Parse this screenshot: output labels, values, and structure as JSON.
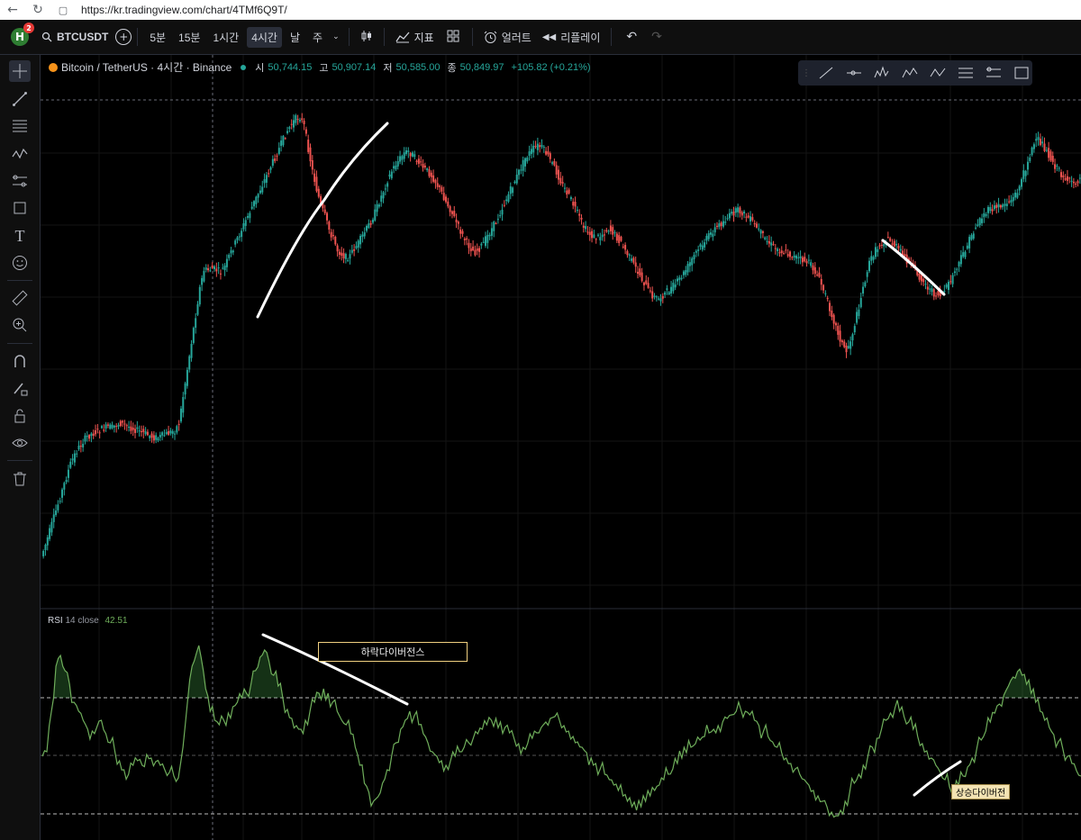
{
  "browser": {
    "url": "https://kr.tradingview.com/chart/4TMf6Q9T/"
  },
  "toolbar": {
    "avatar_letter": "H",
    "avatar_badge": "2",
    "symbol": "BTCUSDT",
    "intervals": [
      "5분",
      "15분",
      "1시간",
      "4시간",
      "날",
      "주"
    ],
    "active_interval": "4시간",
    "indicators_label": "지표",
    "alert_label": "얼러트",
    "replay_label": "리플레이"
  },
  "legend": {
    "symbol": "Bitcoin / TetherUS · 4시간 · Binance",
    "open_label": "시",
    "open": "50,744.15",
    "high_label": "고",
    "high": "50,907.14",
    "low_label": "저",
    "low": "50,585.00",
    "close_label": "종",
    "close": "50,849.97",
    "change": "+105.82 (+0.21%)"
  },
  "rsi": {
    "name": "RSI",
    "params": "14 close",
    "value": "42.51"
  },
  "annotations": {
    "bearish": "하락다이버전스",
    "bullish": "상승다이버전"
  },
  "colors": {
    "up": "#26a69a",
    "down": "#ef5350",
    "rsi_line": "#6fae5b",
    "background": "#000000"
  },
  "chart_data": {
    "type": "candlestick",
    "price_path": [
      618,
      605,
      590,
      575,
      560,
      545,
      530,
      515,
      505,
      497,
      490,
      485,
      482,
      480,
      478,
      476,
      474,
      475,
      472,
      470,
      472,
      474,
      476,
      478,
      480,
      482,
      484,
      486,
      486,
      484,
      482,
      480,
      478,
      470,
      440,
      410,
      380,
      350,
      320,
      300,
      300,
      298,
      300,
      302,
      296,
      285,
      275,
      265,
      255,
      245,
      235,
      225,
      215,
      205,
      195,
      185,
      175,
      165,
      155,
      145,
      138,
      132,
      130,
      140,
      165,
      190,
      210,
      228,
      240,
      255,
      265,
      278,
      282,
      286,
      284,
      276,
      270,
      262,
      254,
      246,
      236,
      224,
      212,
      200,
      190,
      182,
      176,
      170,
      168,
      172,
      178,
      184,
      188,
      192,
      198,
      206,
      214,
      224,
      232,
      242,
      252,
      262,
      270,
      276,
      280,
      276,
      270,
      262,
      254,
      246,
      236,
      226,
      216,
      206,
      196,
      186,
      176,
      170,
      165,
      162,
      164,
      170,
      178,
      186,
      196,
      206,
      214,
      222,
      232,
      242,
      252,
      258,
      262,
      264,
      262,
      258,
      254,
      258,
      264,
      270,
      278,
      286,
      294,
      302,
      310,
      318,
      326,
      330,
      332,
      328,
      324,
      320,
      316,
      310,
      304,
      296,
      288,
      280,
      274,
      268,
      262,
      256,
      252,
      248,
      244,
      240,
      236,
      234,
      236,
      240,
      244,
      250,
      256,
      262,
      268,
      272,
      276,
      278,
      280,
      282,
      284,
      286,
      288,
      290,
      292,
      298,
      306,
      316,
      328,
      342,
      356,
      370,
      382,
      390,
      378,
      360,
      340,
      320,
      300,
      286,
      278,
      272,
      268,
      266,
      270,
      274,
      280,
      286,
      292,
      298,
      304,
      310,
      316,
      322,
      326,
      328,
      326,
      320,
      312,
      302,
      292,
      282,
      272,
      262,
      252,
      244,
      238,
      234,
      232,
      230,
      228,
      226,
      224,
      220,
      212,
      200,
      186,
      172,
      160,
      156,
      160,
      168,
      176,
      184,
      190,
      196,
      200,
      204,
      202,
      198
    ],
    "rsi_path": [
      840,
      835,
      790,
      740,
      728,
      745,
      760,
      780,
      790,
      800,
      810,
      812,
      808,
      800,
      815,
      825,
      835,
      845,
      855,
      860,
      850,
      845,
      850,
      838,
      842,
      846,
      850,
      855,
      858,
      862,
      864,
      830,
      780,
      740,
      725,
      730,
      765,
      790,
      800,
      805,
      800,
      792,
      785,
      780,
      775,
      770,
      760,
      745,
      730,
      722,
      735,
      750,
      762,
      775,
      788,
      798,
      806,
      810,
      800,
      790,
      780,
      770,
      765,
      770,
      780,
      790,
      800,
      805,
      815,
      830,
      850,
      870,
      880,
      890,
      885,
      870,
      855,
      840,
      825,
      810,
      800,
      790,
      795,
      805,
      815,
      825,
      835,
      840,
      845,
      850,
      845,
      840,
      835,
      830,
      825,
      820,
      815,
      810,
      805,
      800,
      798,
      802,
      808,
      814,
      820,
      826,
      830,
      826,
      820,
      814,
      808,
      802,
      798,
      796,
      800,
      806,
      812,
      818,
      824,
      830,
      836,
      842,
      848,
      854,
      860,
      866,
      872,
      878,
      884,
      890,
      896,
      900,
      896,
      890,
      884,
      878,
      872,
      866,
      860,
      854,
      848,
      842,
      836,
      830,
      826,
      822,
      818,
      814,
      810,
      806,
      802,
      798,
      794,
      790,
      788,
      790,
      794,
      800,
      806,
      812,
      818,
      824,
      830,
      836,
      842,
      848,
      854,
      860,
      866,
      872,
      878,
      884,
      890,
      896,
      902,
      906,
      900,
      890,
      880,
      870,
      860,
      850,
      840,
      830,
      820,
      810,
      800,
      792,
      786,
      790,
      796,
      802,
      810,
      818,
      826,
      834,
      842,
      850,
      858,
      866,
      874,
      880,
      872,
      862,
      852,
      842,
      832,
      822,
      812,
      802,
      792,
      782,
      772,
      762,
      752,
      746,
      750,
      760,
      770,
      780,
      790,
      800,
      808,
      816,
      824,
      832,
      840,
      848,
      856,
      862
    ]
  }
}
